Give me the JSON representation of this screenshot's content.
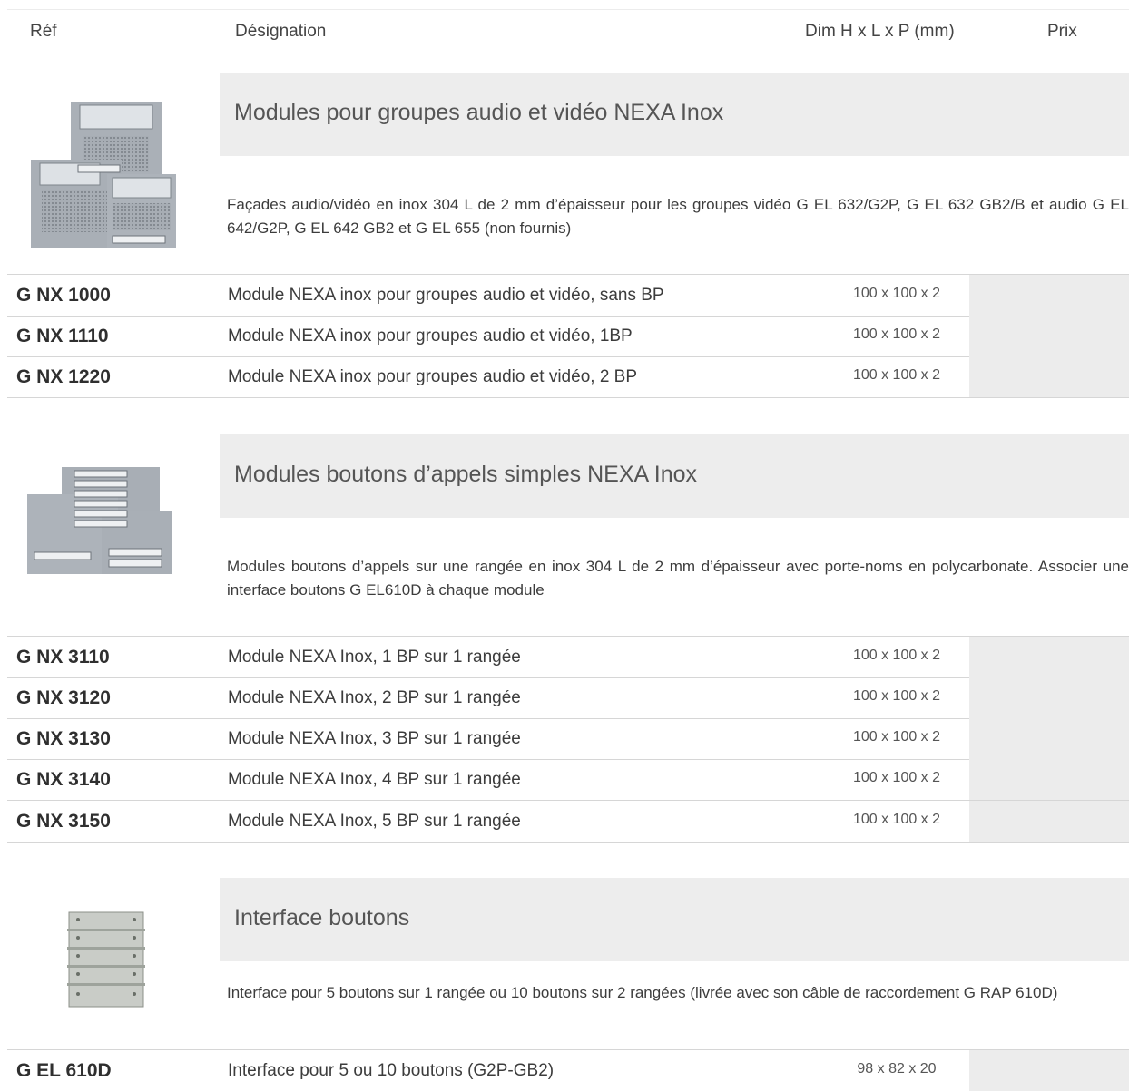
{
  "header": {
    "ref": "Réf",
    "designation": "Désignation",
    "dim": "Dim H x L x P (mm)",
    "price": "Prix"
  },
  "sections": [
    {
      "title": "Modules pour groupes audio et vidéo NEXA Inox",
      "description": "Façades audio/vidéo en inox 304 L de 2 mm d’épaisseur pour les groupes vidéo G EL 632/G2P, G EL 632 GB2/B et audio G EL 642/G2P, G EL 642 GB2 et G EL 655 (non fournis)",
      "image": "audio-video-module-panels",
      "rows": [
        {
          "ref": "G NX 1000",
          "designation": "Module NEXA inox pour groupes audio et vidéo, sans BP",
          "dim": "100 x 100 x 2"
        },
        {
          "ref": "G NX 1110",
          "designation": "Module NEXA inox pour groupes audio et vidéo, 1BP",
          "dim": "100 x 100 x 2"
        },
        {
          "ref": "G NX 1220",
          "designation": "Module NEXA inox pour groupes audio et vidéo, 2 BP",
          "dim": "100 x 100 x 2"
        }
      ]
    },
    {
      "title": "Modules boutons d’appels simples NEXA Inox",
      "description": "Modules boutons d’appels sur une rangée en inox 304 L de 2 mm d’épaisseur avec porte-noms en polycarbonate. Associer une interface boutons G EL610D à chaque module",
      "image": "call-button-module-panels",
      "rows": [
        {
          "ref": "G NX 3110",
          "designation": "Module NEXA Inox, 1 BP sur 1 rangée",
          "dim": "100 x 100 x 2"
        },
        {
          "ref": "G NX 3120",
          "designation": "Module NEXA Inox, 2 BP sur 1 rangée",
          "dim": "100 x 100 x 2"
        },
        {
          "ref": "G NX 3130",
          "designation": "Module NEXA Inox, 3 BP sur 1 rangée",
          "dim": "100 x 100 x 2"
        },
        {
          "ref": "G NX 3140",
          "designation": "Module NEXA Inox, 4 BP sur 1 rangée",
          "dim": "100 x 100 x 2"
        },
        {
          "ref": "G NX 3150",
          "designation": "Module NEXA Inox, 5 BP sur 1 rangée",
          "dim": "100 x 100 x 2"
        }
      ]
    },
    {
      "title": "Interface boutons",
      "description": "Interface pour 5 boutons sur 1 rangée ou 10 boutons sur 2 rangées (livrée avec son câble de raccordement G RAP 610D)",
      "image": "button-interface-board",
      "rows": [
        {
          "ref": "G EL 610D",
          "designation": "Interface pour 5 ou 10 boutons (G2P-GB2)",
          "dim": "98 x 82 x 20"
        }
      ]
    }
  ]
}
